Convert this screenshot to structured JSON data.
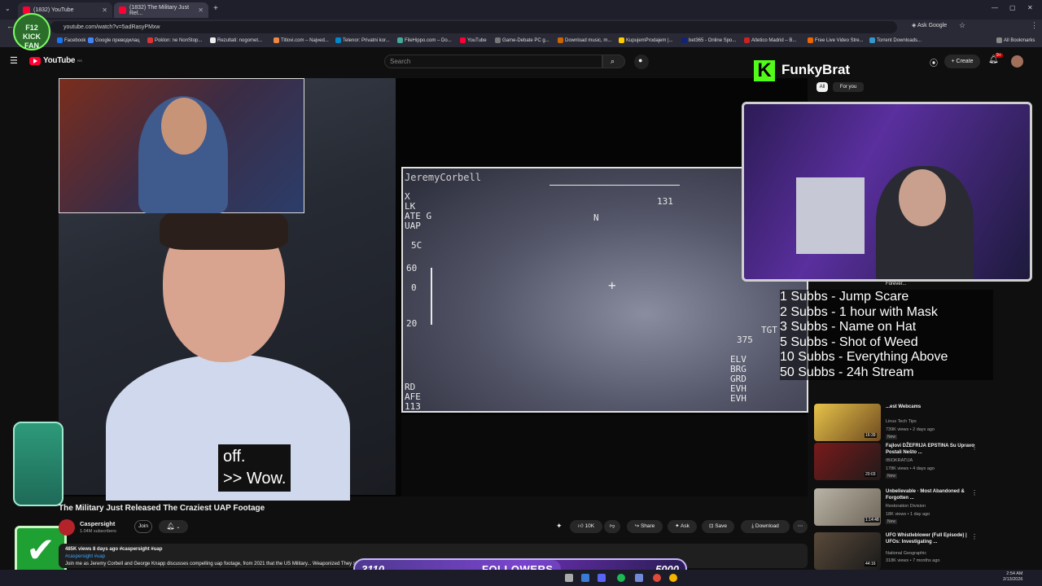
{
  "browser": {
    "tabs": [
      {
        "title": "(1832) YouTube"
      },
      {
        "title": "(1832) The Military Just Rel..."
      }
    ],
    "url": "youtube.com/watch?v=5adRasyPMxw",
    "ask_google": "Ask Google",
    "bookmarks": [
      "Facebook",
      "Google преводилац",
      "Poklon: ne NonStop...",
      "Rezultati: nogomet...",
      "Titlovi.com – Najved...",
      "Telenor: Privatni kor...",
      "FileHippo.com – Do...",
      "YouTube",
      "Game-Debate PC g...",
      "Download music, m...",
      "KupujemProdajem |...",
      "bet365 - Online Spo...",
      "Atletico Madrid – B...",
      "Free Live Video Stre...",
      "Torrent Downloads..."
    ],
    "all_bookmarks": "All Bookmarks"
  },
  "youtube": {
    "logo": "YouTube",
    "logo_sup": "RS",
    "search_placeholder": "Search",
    "create_label": "Create",
    "notif_count": "9+"
  },
  "overlay": {
    "badge_text": "F12\nKICK\nFAN",
    "streamer_logo": "K",
    "streamer_name": "FunkyBrat",
    "chip_all": "All",
    "chip_for_you": "For you",
    "caption": "off.\n>> Wow.",
    "subgoals": [
      "1 Subbs - Jump Scare",
      "2 Subbs - 1 hour with Mask",
      "3 Subbs - Name on Hat",
      "5 Subbs - Shot of Weed",
      "10 Subbs - Everything Above",
      "50 Subbs - 24h Stream"
    ],
    "followers_current": "3110",
    "followers_label": "FOLLOWERS",
    "followers_goal": "5000",
    "followers_progress": 0.622
  },
  "flir": {
    "watermark": "JeremyCorbell",
    "lines_left": [
      "X",
      "LK",
      "ATE G",
      "UAP",
      "5C",
      "60",
      "0",
      "20"
    ],
    "heading": "N",
    "num_top": "131",
    "range": "375",
    "tgt": "TGT",
    "lines_right": [
      "ELV",
      "BRG",
      "GRD",
      "EVH",
      "EVH"
    ],
    "lines_bottom": [
      "RD",
      "AFE",
      "113"
    ]
  },
  "video": {
    "title": "The Military Just Released The Craziest UAP Footage",
    "channel": "Caspersight",
    "subscribers": "1.04M subscribers",
    "join": "Join",
    "likes": "10K",
    "share": "Share",
    "ask": "Ask",
    "save": "Save",
    "download": "Download",
    "desc_stats": "485K views  8 days ago  #caspersight #uap",
    "desc_tags": "#caspersight #uap",
    "desc_text": "Join me as Jeremy Corbell and George Knapp discusses compelling uap footage, from 2021 that the US Military...  Weaponized They showcase what ... unidentified aerial phenomena captured by"
  },
  "sidebar": {
    "items": [
      {
        "title": "Forever...",
        "channel": "",
        "meta": "",
        "badge": "",
        "duration": ""
      },
      {
        "title": "...est Webcams",
        "channel": "Linus Tech Tips",
        "meta": "739K views • 2 days ago",
        "badge": "New",
        "duration": "16:39"
      },
      {
        "title": "Fajlovi DŽEFRIJA EPSTINA Su Upravo Postali Nešto ...",
        "channel": "IBIOKRATIJA",
        "meta": "178K views • 4 days ago",
        "badge": "New",
        "duration": "20:03"
      },
      {
        "title": "Unbelievable · Most Abandoned & Forgotten ...",
        "channel": "Restoration Division",
        "meta": "18K views • 1 day ago",
        "badge": "New",
        "duration": "1:14:48"
      },
      {
        "title": "UFO Whistleblower (Full Episode) | UFOs: Investigating ...",
        "channel": "National Geographic",
        "meta": "318K views • 7 months ago",
        "badge": "",
        "duration": "44:16"
      }
    ]
  },
  "taskbar": {
    "time": "2:54 AM",
    "date": "2/13/2026"
  },
  "colors": {
    "yt_red": "#ff0033",
    "kick_green": "#53fc18",
    "bg": "#0f0f0f"
  }
}
